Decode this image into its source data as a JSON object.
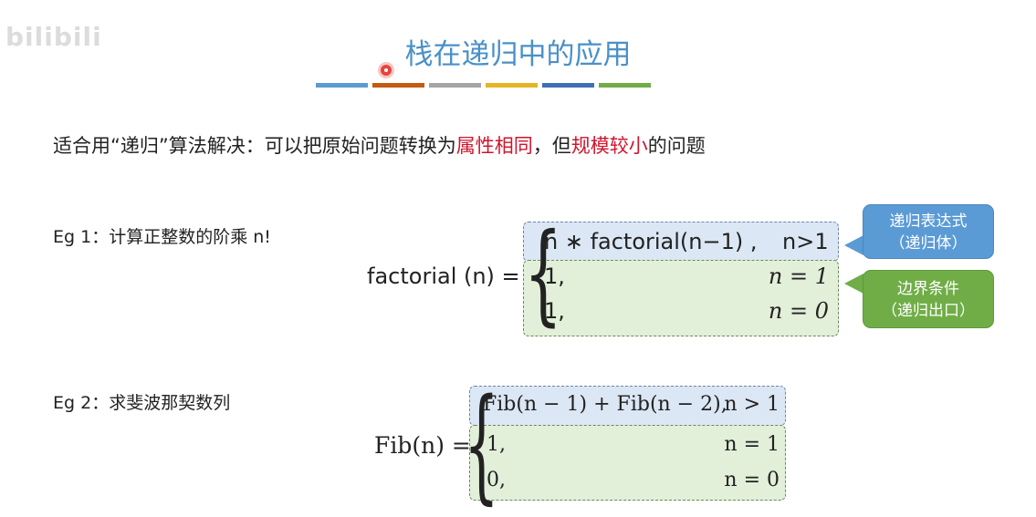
{
  "watermark": "bilibili",
  "slide": {
    "title": "栈在递归中的应用",
    "title_bar_colors": [
      "#5b9bd5",
      "#c55a11",
      "#a5a5a5",
      "#e5b525",
      "#3f6fb5",
      "#70ad47"
    ],
    "intro": {
      "part1": "适合用“递归”算法解决：可以把原始问题转换为",
      "red1": "属性相同",
      "part2": "，但",
      "red2": "规模较小",
      "part3": "的问题"
    },
    "eg1": {
      "label": "Eg 1：计算正整数的阶乘 n!",
      "lhs": "factorial (n) =",
      "case1_expr": "n ∗ factorial(n−1) ,",
      "case1_cond": "n>1",
      "case2_expr": "1,",
      "case2_cond": "n = 1",
      "case3_expr": "1,",
      "case3_cond": "n = 0"
    },
    "callouts": {
      "recursive_line1": "递归表达式",
      "recursive_line2": "（递归体）",
      "boundary_line1": "边界条件",
      "boundary_line2": "（递归出口）"
    },
    "eg2": {
      "label": "Eg 2：求斐波那契数列",
      "lhs": "Fib(n) =",
      "case1_expr": "Fib(n − 1) + Fib(n − 2),",
      "case1_cond": "n > 1",
      "case2_expr": "1,",
      "case2_cond": "n = 1",
      "case3_expr": "0,",
      "case3_cond": "n = 0"
    },
    "colors": {
      "title": "#4a90c8",
      "highlight_red": "#d0142c",
      "recursive_box": "#dbe7f4",
      "boundary_box": "#e2efd9",
      "callout_blue": "#5b9bd5",
      "callout_green": "#70ad47"
    }
  }
}
